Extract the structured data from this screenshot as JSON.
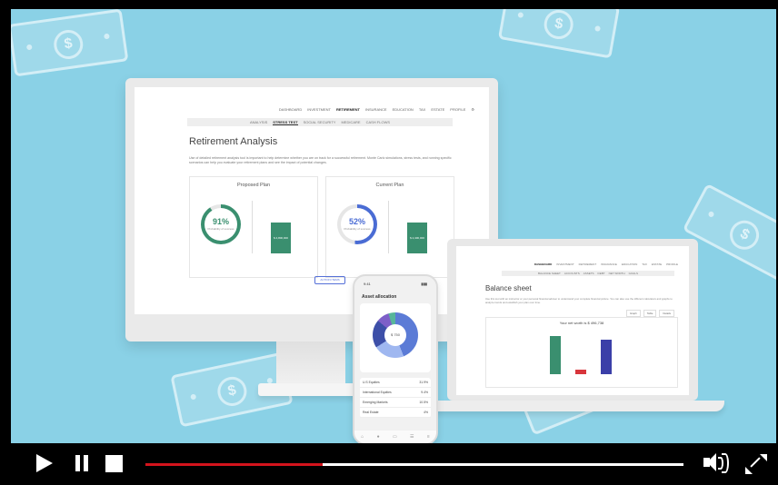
{
  "monitor": {
    "nav": [
      "DASHBOARD",
      "INVESTMENT",
      "RETIREMENT",
      "INSURANCE",
      "EDUCATION",
      "TAX",
      "ESTATE",
      "PROFILE"
    ],
    "nav_active": 2,
    "subnav": [
      "ANALYSIS",
      "STRESS TEST",
      "SOCIAL SECURITY",
      "MEDICARE",
      "CASH FLOWS"
    ],
    "subnav_active": 1,
    "title": "Retirement Analysis",
    "description": "Use of detailed retirement analysis tool is important to help determine whether you are on track for a successful retirement. Monte Carlo simulations, stress tests, and running specific scenarios can help you evaluate your retirement plans and see the impact of potential changes.",
    "panels": [
      {
        "title": "Proposed Plan",
        "percent": "91%",
        "percent_value": 91,
        "sub": "Probability of success",
        "bar_label": "$ 4,800,000",
        "ring_color": "#3a8f6f"
      },
      {
        "title": "Current Plan",
        "percent": "52%",
        "percent_value": 52,
        "sub": "Probability of success",
        "bar_label": "$ 2,400,000",
        "ring_color": "#4a6cd4"
      }
    ],
    "action_button": "ACTION ITEMS"
  },
  "laptop": {
    "nav": [
      "DASHBOARD",
      "INVESTMENT",
      "RETIREMENT",
      "INSURANCE",
      "EDUCATION",
      "TAX",
      "ESTATE",
      "PROFILE"
    ],
    "nav_active": 0,
    "subnav": [
      "BALANCE SHEET",
      "ACCOUNTS",
      "ASSETS",
      "DEBT",
      "NET WORTH",
      "GOALS"
    ],
    "title": "Balance sheet",
    "description": "Use this tool with an instructor or your personal financial adviser to understand your complete financial picture. You can also use the different calculators and graphs to analyze trends and establish your plan over time.",
    "tabs": [
      "Graph",
      "Table",
      "Details"
    ],
    "chart_title": "Your net worth is $ 496,738"
  },
  "phone": {
    "time": "9:41",
    "signal": "▮▮▮",
    "header": "Asset allocation",
    "donut_center": "$ 750",
    "rows": [
      {
        "label": "U.S Equities",
        "value": "31.9%"
      },
      {
        "label": "International Equities",
        "value": "9.4%"
      },
      {
        "label": "Emerging Markets",
        "value": "10.5%"
      },
      {
        "label": "Real Estate",
        "value": "4%"
      }
    ],
    "tabbar": [
      "⌂",
      "●",
      "▭",
      "☰",
      "≡"
    ]
  },
  "player": {
    "progress_fraction": 0.33,
    "accent": "#d3131c"
  }
}
